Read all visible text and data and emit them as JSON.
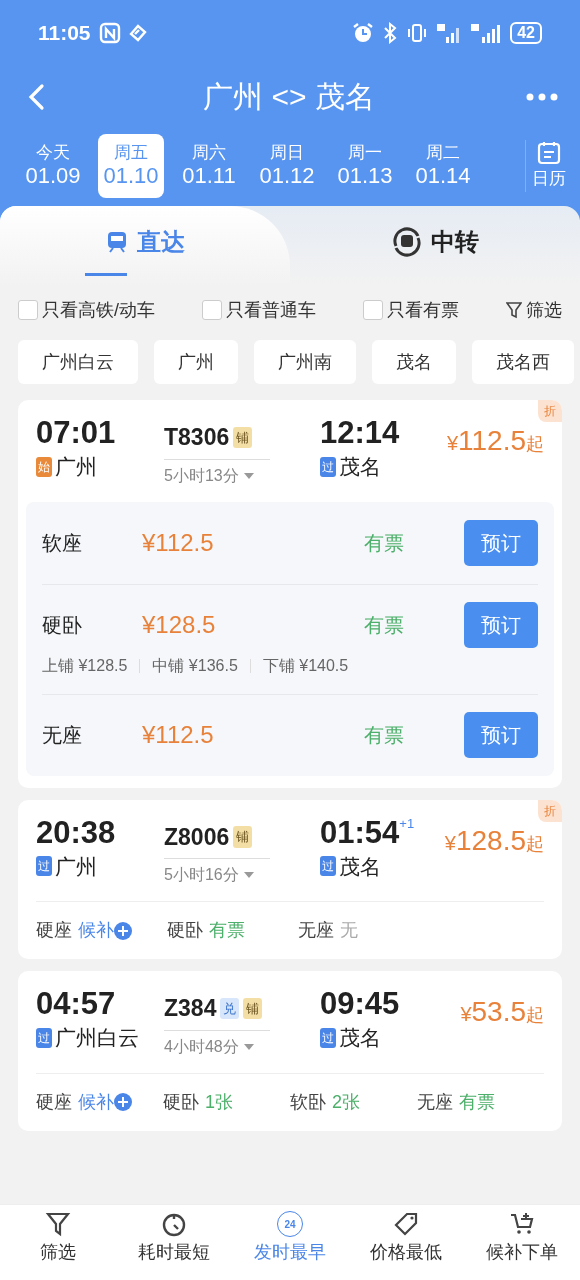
{
  "status_bar": {
    "time": "11:05",
    "battery": "42"
  },
  "header": {
    "title": "广州 <> 茂名"
  },
  "dates": [
    {
      "weekday": "今天",
      "date": "01.09",
      "selected": false
    },
    {
      "weekday": "周五",
      "date": "01.10",
      "selected": true
    },
    {
      "weekday": "周六",
      "date": "01.11",
      "selected": false
    },
    {
      "weekday": "周日",
      "date": "01.12",
      "selected": false
    },
    {
      "weekday": "周一",
      "date": "01.13",
      "selected": false
    },
    {
      "weekday": "周二",
      "date": "01.14",
      "selected": false
    }
  ],
  "calendar_button": "日历",
  "tabs": [
    {
      "label": "直达",
      "selected": true
    },
    {
      "label": "中转",
      "selected": false
    }
  ],
  "filters": [
    {
      "label": "只看高铁/动车",
      "checked": false
    },
    {
      "label": "只看普通车",
      "checked": false
    },
    {
      "label": "只看有票",
      "checked": false
    }
  ],
  "filter_button": "筛选",
  "stations": [
    {
      "label": "广州白云",
      "selected": false
    },
    {
      "label": "广州",
      "selected": false
    },
    {
      "label": "广州南",
      "selected": false
    },
    {
      "label": "茂名",
      "selected": false
    },
    {
      "label": "茂名西",
      "selected": false
    }
  ],
  "trains": [
    {
      "depart": "07:01",
      "from_tag": {
        "text": "始",
        "kind": "start"
      },
      "from": "广州",
      "number": "T8306",
      "badges": [
        {
          "text": "铺",
          "kind": "berth"
        }
      ],
      "duration": "5小时13分",
      "arrive": "12:14",
      "to_tag": "过",
      "to": "茂名",
      "currency": "¥",
      "price": "112.5",
      "price_suffix": "起",
      "discount": "折",
      "expanded": true,
      "seats": [
        {
          "name": "软座",
          "price": "¥112.5",
          "status": "有票",
          "button": "预订"
        },
        {
          "name": "硬卧",
          "price": "¥128.5",
          "status": "有票",
          "button": "预订",
          "berths": [
            "上铺 ¥128.5",
            "中铺 ¥136.5",
            "下铺 ¥140.5"
          ]
        },
        {
          "name": "无座",
          "price": "¥112.5",
          "status": "有票",
          "button": "预订"
        }
      ]
    },
    {
      "depart": "20:38",
      "from_tag": {
        "text": "过",
        "kind": "pass"
      },
      "from": "广州",
      "number": "Z8006",
      "badges": [
        {
          "text": "铺",
          "kind": "berth"
        }
      ],
      "duration": "5小时16分",
      "arrive": "01:54",
      "day_offset": "+1",
      "to_tag": "过",
      "to": "茂名",
      "currency": "¥",
      "price": "128.5",
      "price_suffix": "起",
      "discount": "折",
      "expanded": false,
      "seats": [
        {
          "name": "硬座",
          "status": "候补",
          "kind": "waitlist"
        },
        {
          "name": "硬卧",
          "status": "有票",
          "kind": "available"
        },
        {
          "name": "无座",
          "status": "无",
          "kind": "none"
        }
      ]
    },
    {
      "depart": "04:57",
      "from_tag": {
        "text": "过",
        "kind": "pass"
      },
      "from": "广州白云",
      "number": "Z384",
      "badges": [
        {
          "text": "兑",
          "kind": "redeem"
        },
        {
          "text": "铺",
          "kind": "berth"
        }
      ],
      "duration": "4小时48分",
      "arrive": "09:45",
      "to_tag": "过",
      "to": "茂名",
      "currency": "¥",
      "price": "53.5",
      "price_suffix": "起",
      "expanded": false,
      "seats": [
        {
          "name": "硬座",
          "status": "候补",
          "kind": "waitlist"
        },
        {
          "name": "硬卧",
          "status": "1张",
          "kind": "available"
        },
        {
          "name": "软卧",
          "status": "2张",
          "kind": "available"
        },
        {
          "name": "无座",
          "status": "有票",
          "kind": "available"
        }
      ]
    }
  ],
  "bottom_nav": [
    {
      "label": "筛选",
      "kind": "filter",
      "selected": false
    },
    {
      "label": "耗时最短",
      "kind": "timer",
      "selected": false
    },
    {
      "label": "发时最早",
      "kind": "clock",
      "icon_text": "24",
      "selected": true
    },
    {
      "label": "价格最低",
      "kind": "tag",
      "selected": false
    },
    {
      "label": "候补下单",
      "kind": "cart",
      "selected": false
    }
  ]
}
